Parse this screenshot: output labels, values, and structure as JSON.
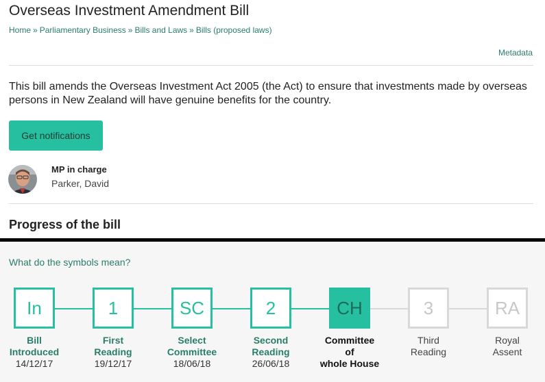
{
  "page": {
    "title": "Overseas Investment Amendment Bill",
    "metadata_link": "Metadata"
  },
  "breadcrumb": {
    "items": [
      "Home",
      "Parliamentary Business",
      "Bills and Laws",
      "Bills (proposed laws)"
    ],
    "separator": "»"
  },
  "summary": {
    "text": "This bill amends the Overseas Investment Act 2005 (the Act) to ensure that investments made by overseas persons in New Zealand will have genuine benefits for the country."
  },
  "actions": {
    "notifications_label": "Get notifications"
  },
  "mp": {
    "label": "MP in charge",
    "name": "Parker, David"
  },
  "progress": {
    "heading": "Progress of the bill",
    "symbols_link": "What do the symbols mean?",
    "stages": [
      {
        "abbr": "In",
        "name_lines": [
          "Bill",
          "Introduced"
        ],
        "date": "14/12/17",
        "status": "done"
      },
      {
        "abbr": "1",
        "name_lines": [
          "First",
          "Reading"
        ],
        "date": "19/12/17",
        "status": "done"
      },
      {
        "abbr": "SC",
        "name_lines": [
          "Select",
          "Committee"
        ],
        "date": "18/06/18",
        "status": "done"
      },
      {
        "abbr": "2",
        "name_lines": [
          "Second",
          "Reading"
        ],
        "date": "26/06/18",
        "status": "done"
      },
      {
        "abbr": "CH",
        "name_lines": [
          "Committee",
          "of",
          "whole House"
        ],
        "date": "",
        "status": "current"
      },
      {
        "abbr": "3",
        "name_lines": [
          "Third",
          "Reading"
        ],
        "date": "",
        "status": "future"
      },
      {
        "abbr": "RA",
        "name_lines": [
          "Royal",
          "Assent"
        ],
        "date": "",
        "status": "future"
      }
    ]
  },
  "colors": {
    "accent": "#26c0a1",
    "link": "#2a7d6b",
    "future": "#d8d8d8"
  },
  "icons": {
    "avatar": "person-photo"
  }
}
